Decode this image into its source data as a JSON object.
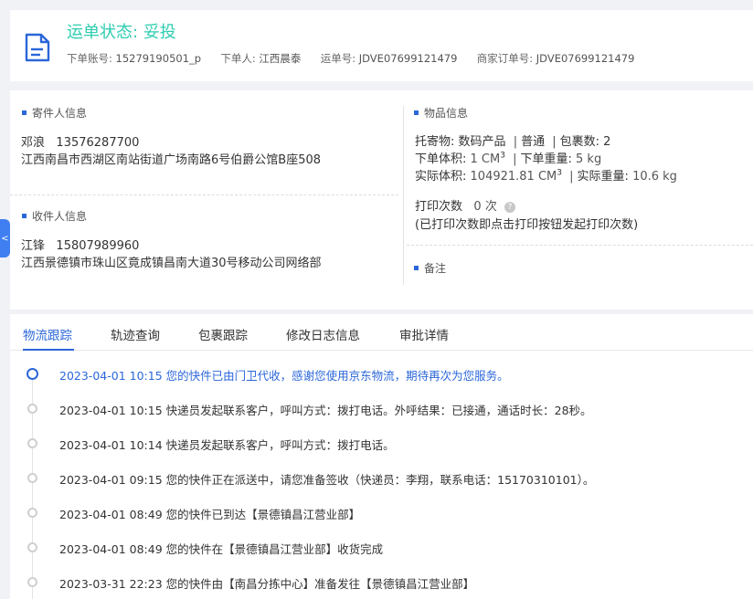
{
  "header": {
    "status_label": "运单状态:",
    "status_value": "妥投",
    "meta": [
      {
        "label": "下单账号:",
        "value": "15279190501_p"
      },
      {
        "label": "下单人:",
        "value": "江西晨泰"
      },
      {
        "label": "运单号:",
        "value": "JDVE07699121479"
      },
      {
        "label": "商家订单号:",
        "value": "JDVE07699121479"
      }
    ]
  },
  "sender": {
    "title": "寄件人信息",
    "name": "邓浪",
    "phone": "13576287700",
    "address": "江西南昌市西湖区南站街道广场南路6号伯爵公馆B座508"
  },
  "receiver": {
    "title": "收件人信息",
    "name": "江锋",
    "phone": "15807989960",
    "address": "江西景德镇市珠山区竟成镇昌南大道30号移动公司网络部"
  },
  "goods": {
    "title": "物品信息",
    "cargo_label": "托寄物:",
    "cargo_value": "数码产品",
    "service": "普通",
    "package_label": "包裹数:",
    "package_count": "2",
    "order_volume_label": "下单体积:",
    "order_volume": "1 CM",
    "order_weight_label": "下单重量:",
    "order_weight": "5 kg",
    "actual_volume_label": "实际体积:",
    "actual_volume": "104921.81 CM",
    "actual_weight_label": "实际重量:",
    "actual_weight": "10.6 kg",
    "superscript": "3",
    "print_label": "打印次数",
    "print_count": "0 次",
    "help_glyph": "?",
    "print_hint": "(已打印次数即点击打印按钮发起打印次数)"
  },
  "remark": {
    "title": "备注"
  },
  "side_tab": {
    "icon": "chevron-left-icon",
    "glyph": "<"
  },
  "tabs": [
    "物流跟踪",
    "轨迹查询",
    "包裹跟踪",
    "修改日志信息",
    "审批详情"
  ],
  "active_tab": 0,
  "timeline": [
    "2023-04-01 10:15 您的快件已由门卫代收，感谢您使用京东物流，期待再次为您服务。",
    "2023-04-01 10:15 快递员发起联系客户，呼叫方式：拨打电话。外呼结果：已接通，通话时长：28秒。",
    "2023-04-01 10:14 快递员发起联系客户，呼叫方式：拨打电话。",
    "2023-04-01 09:15 您的快件正在派送中，请您准备签收（快递员：李翔，联系电话：15170310101）。",
    "2023-04-01 08:49 您的快件已到达【景德镇昌江营业部】",
    "2023-04-01 08:49 您的快件在【景德镇昌江营业部】收货完成",
    "2023-03-31 22:23 您的快件由【南昌分拣中心】准备发往【景德镇昌江营业部】"
  ],
  "colors": {
    "accent": "#2b67d9",
    "status": "#2fcdb0"
  }
}
